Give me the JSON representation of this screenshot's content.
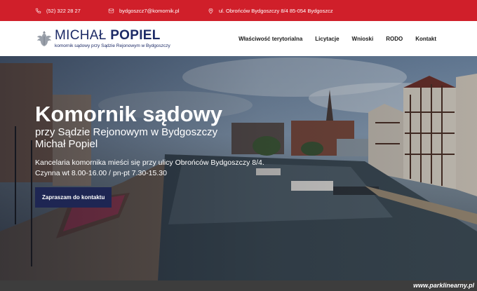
{
  "topbar": {
    "phone": "(52) 322 28 27",
    "email": "bydgoszcz7@komornik.pl",
    "address": "ul. Obrońców Bydgoszczy 8/4 85-054 Bydgoszcz"
  },
  "header": {
    "logo_first": "MICHAŁ",
    "logo_last": "POPIEL",
    "logo_subtitle": "komornik sądowy przy Sądzie Rejonowym w Bydgoszczy",
    "nav": [
      "Właściwość terytorialna",
      "Licytacje",
      "Wnioski",
      "RODO",
      "Kontakt"
    ]
  },
  "hero": {
    "title": "Komornik sądowy",
    "subtitle_line1": "przy Sądzie Rejonowym w Bydgoszczy",
    "subtitle_line2": "Michał Popiel",
    "desc_line1": "Kancelaria komornika mieści się przy ulicy Obrońców Bydgoszczy 8/4.",
    "desc_line2": "Czynna wt 8.00-16.00 / pn-pt 7.30-15.30",
    "cta": "Zapraszam do kontaktu"
  },
  "watermark": "www.parklinearny.pl",
  "colors": {
    "topbar": "#d01f2a",
    "brand": "#1c2a66",
    "cta": "#1e2653"
  },
  "icons": {
    "phone": "phone-icon",
    "email": "envelope-icon",
    "address": "location-pin-icon",
    "logo": "eagle-emblem-icon"
  }
}
